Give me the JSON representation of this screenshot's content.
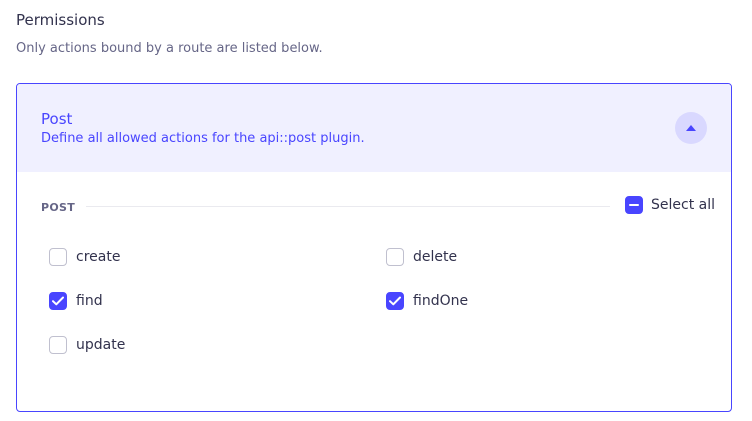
{
  "header": {
    "title": "Permissions",
    "subtitle": "Only actions bound by a route are listed below."
  },
  "panel": {
    "title": "Post",
    "description": "Define all allowed actions for the api::post plugin.",
    "expanded": true,
    "section": {
      "label": "POST",
      "select_all_label": "Select all",
      "select_all_state": "indeterminate",
      "actions": [
        {
          "label": "create",
          "checked": false
        },
        {
          "label": "delete",
          "checked": false
        },
        {
          "label": "find",
          "checked": true
        },
        {
          "label": "findOne",
          "checked": true
        },
        {
          "label": "update",
          "checked": false
        }
      ]
    }
  },
  "colors": {
    "accent": "#4945ff",
    "header_bg": "#f0f0ff",
    "text": "#32324d",
    "muted": "#666687"
  }
}
